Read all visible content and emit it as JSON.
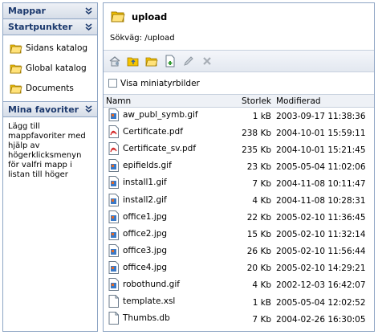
{
  "sidebar": {
    "mappar_title": "Mappar",
    "startpunkter_title": "Startpunkter",
    "start_items": [
      {
        "label": "Sidans katalog",
        "icon": "folder-icon"
      },
      {
        "label": "Global katalog",
        "icon": "folder-icon"
      },
      {
        "label": "Documents",
        "icon": "folder-icon"
      }
    ],
    "favorites_title": "Mina favoriter",
    "favorites_help": "Lägg till mappfavoriter med hjälp av högerklicksmenyn för valfri mapp i listan till höger"
  },
  "folder": {
    "name": "upload",
    "path_label": "Sökväg: /upload"
  },
  "toolbar": {
    "buttons": [
      "home-icon",
      "folder-up-icon",
      "new-folder-icon",
      "new-file-icon",
      "edit-icon",
      "delete-icon"
    ]
  },
  "thumbs_label": "Visa miniatyrbilder",
  "table": {
    "col_name": "Namn",
    "col_size": "Storlek",
    "col_modified": "Modifierad",
    "rows": [
      {
        "name": "aw_publ_symb.gif",
        "size": "1 kB",
        "modified": "2003-09-17 11:38:36",
        "type": "image"
      },
      {
        "name": "Certificate.pdf",
        "size": "238 Kb",
        "modified": "2004-10-01 15:59:11",
        "type": "pdf"
      },
      {
        "name": "Certificate_sv.pdf",
        "size": "235 Kb",
        "modified": "2004-10-01 15:21:45",
        "type": "pdf"
      },
      {
        "name": "epifields.gif",
        "size": "23 Kb",
        "modified": "2005-05-04 11:02:06",
        "type": "image"
      },
      {
        "name": "install1.gif",
        "size": "7 Kb",
        "modified": "2004-11-08 10:11:47",
        "type": "image"
      },
      {
        "name": "install2.gif",
        "size": "4 Kb",
        "modified": "2004-11-08 10:28:31",
        "type": "image"
      },
      {
        "name": "office1.jpg",
        "size": "22 Kb",
        "modified": "2005-02-10 11:36:45",
        "type": "image"
      },
      {
        "name": "office2.jpg",
        "size": "15 Kb",
        "modified": "2005-02-10 11:32:14",
        "type": "image"
      },
      {
        "name": "office3.jpg",
        "size": "26 Kb",
        "modified": "2005-02-10 11:56:44",
        "type": "image"
      },
      {
        "name": "office4.jpg",
        "size": "20 Kb",
        "modified": "2005-02-10 14:29:21",
        "type": "image"
      },
      {
        "name": "robothund.gif",
        "size": "4 Kb",
        "modified": "2002-12-03 16:42:07",
        "type": "image"
      },
      {
        "name": "template.xsl",
        "size": "1 kB",
        "modified": "2005-05-04 12:02:52",
        "type": "doc"
      },
      {
        "name": "Thumbs.db",
        "size": "7 Kb",
        "modified": "2004-02-26 16:30:05",
        "type": "doc"
      }
    ]
  },
  "colors": {
    "panel_border": "#8ea5c4",
    "header_text": "#1d3a6e",
    "folder_yellow": "#f5c400"
  }
}
